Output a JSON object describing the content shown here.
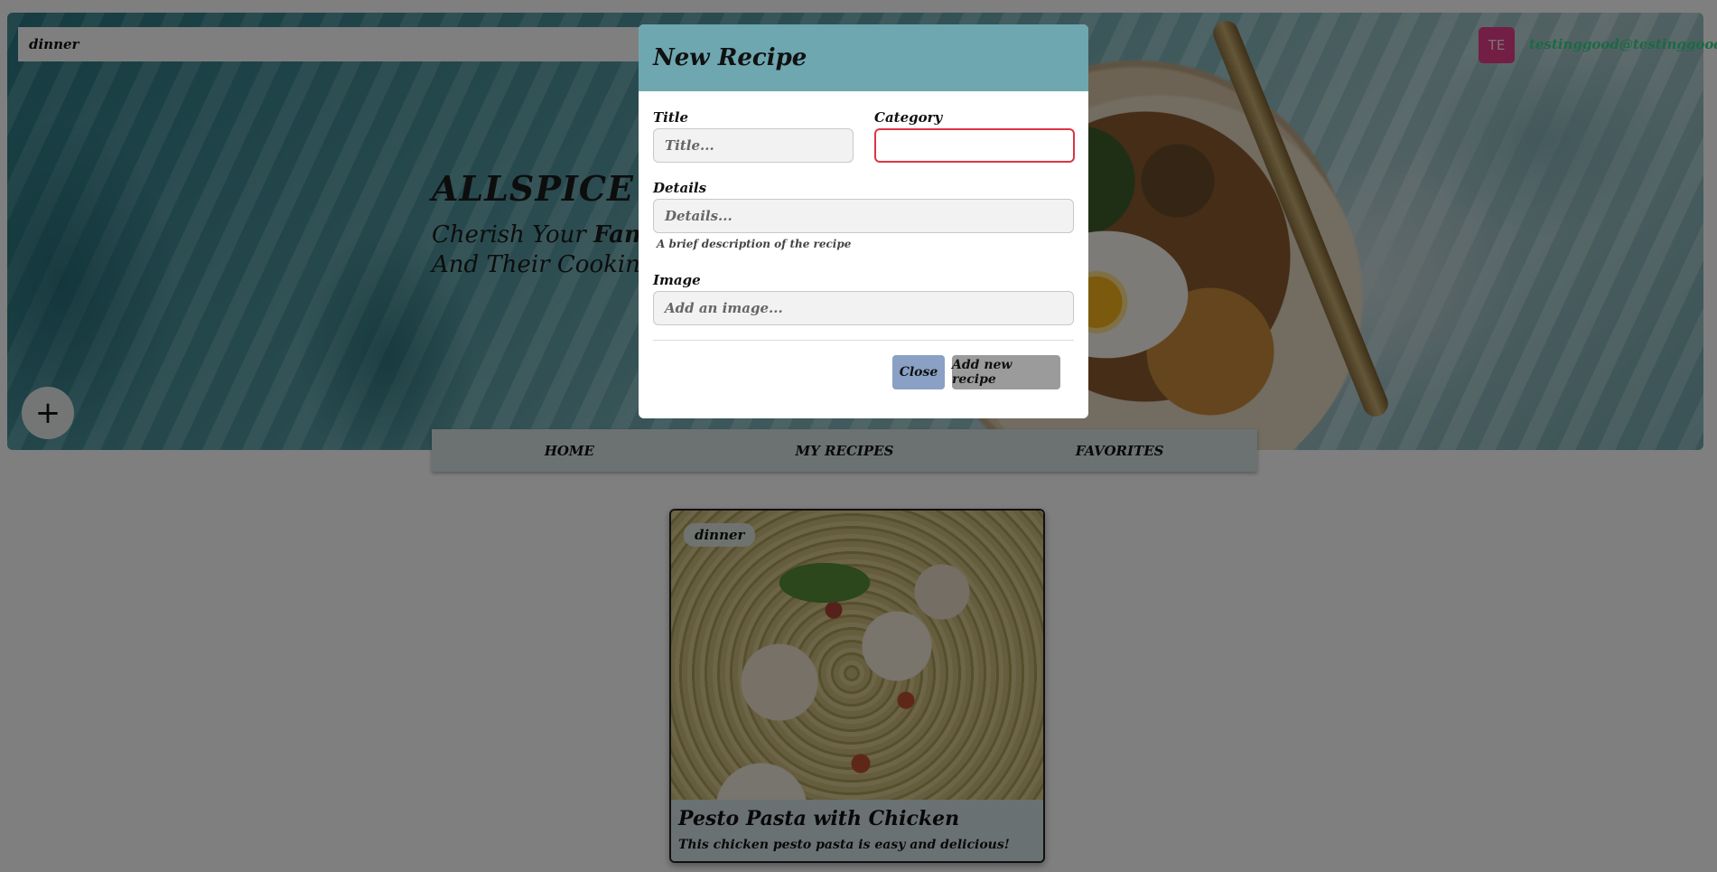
{
  "search": {
    "value": "dinner"
  },
  "user": {
    "avatar_initials": "TE",
    "email": "testinggood@testinggood.com"
  },
  "hero": {
    "brand": "ALLSPICE",
    "tagline_line1_prefix": "Cherish Your ",
    "tagline_line1_bold": "Family",
    "tagline_line2": "And Their Cooking",
    "fab_label": "+"
  },
  "nav": {
    "items": [
      "HOME",
      "MY RECIPES",
      "FAVORITES"
    ]
  },
  "recipe_card": {
    "category": "dinner",
    "title": "Pesto Pasta with Chicken",
    "description": "This chicken pesto pasta is easy and delicious!"
  },
  "modal": {
    "title": "New Recipe",
    "fields": {
      "title": {
        "label": "Title",
        "placeholder": "Title...",
        "value": ""
      },
      "category": {
        "label": "Category",
        "value": "",
        "invalid": true
      },
      "details": {
        "label": "Details",
        "placeholder": "Details...",
        "help": "A brief description of the recipe"
      },
      "image": {
        "label": "Image",
        "placeholder": "Add an image..."
      }
    },
    "buttons": {
      "close": "Close",
      "add": "Add new recipe"
    }
  },
  "colors": {
    "modal_header": "#6ea7b0",
    "invalid_border": "#dc3545",
    "avatar_bg": "#e43d8a",
    "email_text": "#38d38a",
    "close_button": "#8aa0c4",
    "add_button": "#9b9b9b"
  }
}
